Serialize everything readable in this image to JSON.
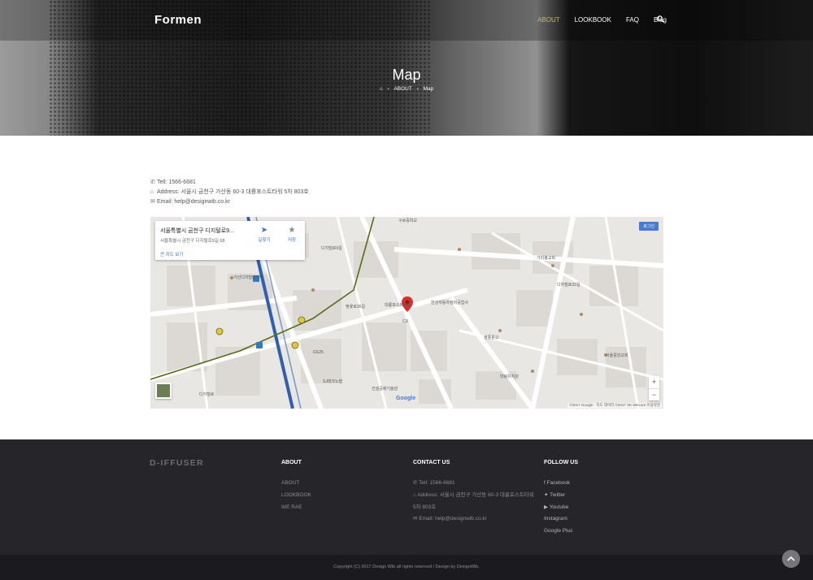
{
  "header": {
    "logo": "Formen",
    "menu": [
      "ABOUT",
      "LOOKBOOK",
      "FAQ",
      "Blog"
    ],
    "active_index": 0,
    "accent_color": "#c9b47a"
  },
  "hero": {
    "title": "Map",
    "breadcrumb": [
      "ABOUT",
      "Map"
    ]
  },
  "contact": {
    "tel": "Tell: 1566-6681",
    "address": "Address: 서울시 금천구 가산동 60-3 대륭포스트타워 5차 803호",
    "email": "Email: help@designwib.co.kr"
  },
  "map": {
    "card_title": "서울특별시 금천구 디지털로9...",
    "card_address": "서울특별시 금천구 디지털로9길 68",
    "card_link": "큰 지도 보기",
    "directions_label": "길찾기",
    "save_label": "저장",
    "signin_label": "로그인",
    "zoom_in": "+",
    "zoom_out": "−",
    "google_logo": "Google",
    "credit": "©2017 Google - 지도 데이터 ©2017 SK telecom  이용약관",
    "labels": [
      "가산디지털단지역",
      "디지털로9길",
      "벚꽃로36길",
      "대륭포스트5차",
      "CU",
      "GS25",
      "영풍문고",
      "디지털로33길",
      "구로중학교",
      "가리봉교회",
      "한성자동차정비공업사",
      "SJ테크노빌",
      "건설공제기술원",
      "대림유치원",
      "서울중앙교회",
      "디지털로"
    ]
  },
  "footer": {
    "brand": "D-IFFUSER",
    "about": {
      "title": "ABOUT",
      "items": [
        "ABOUT",
        "LOOKBOOK",
        "WE RAE"
      ]
    },
    "contact": {
      "title": "CONTACT US",
      "tel": "Tell: 1566-6681",
      "address": "Address: 서울시 금천구 가산동 60-3 대륭포스트타워 5차 803호",
      "email": "Email: help@designwib.co.kr"
    },
    "follow": {
      "title": "FOLLOW US",
      "items": [
        "Facebook",
        "Twitter",
        "Youtube",
        "Instagram",
        "Google Plus"
      ]
    },
    "copyright": "Copyright (C) 2017 Design Wib all rights reserved / Design by DesignWib."
  }
}
